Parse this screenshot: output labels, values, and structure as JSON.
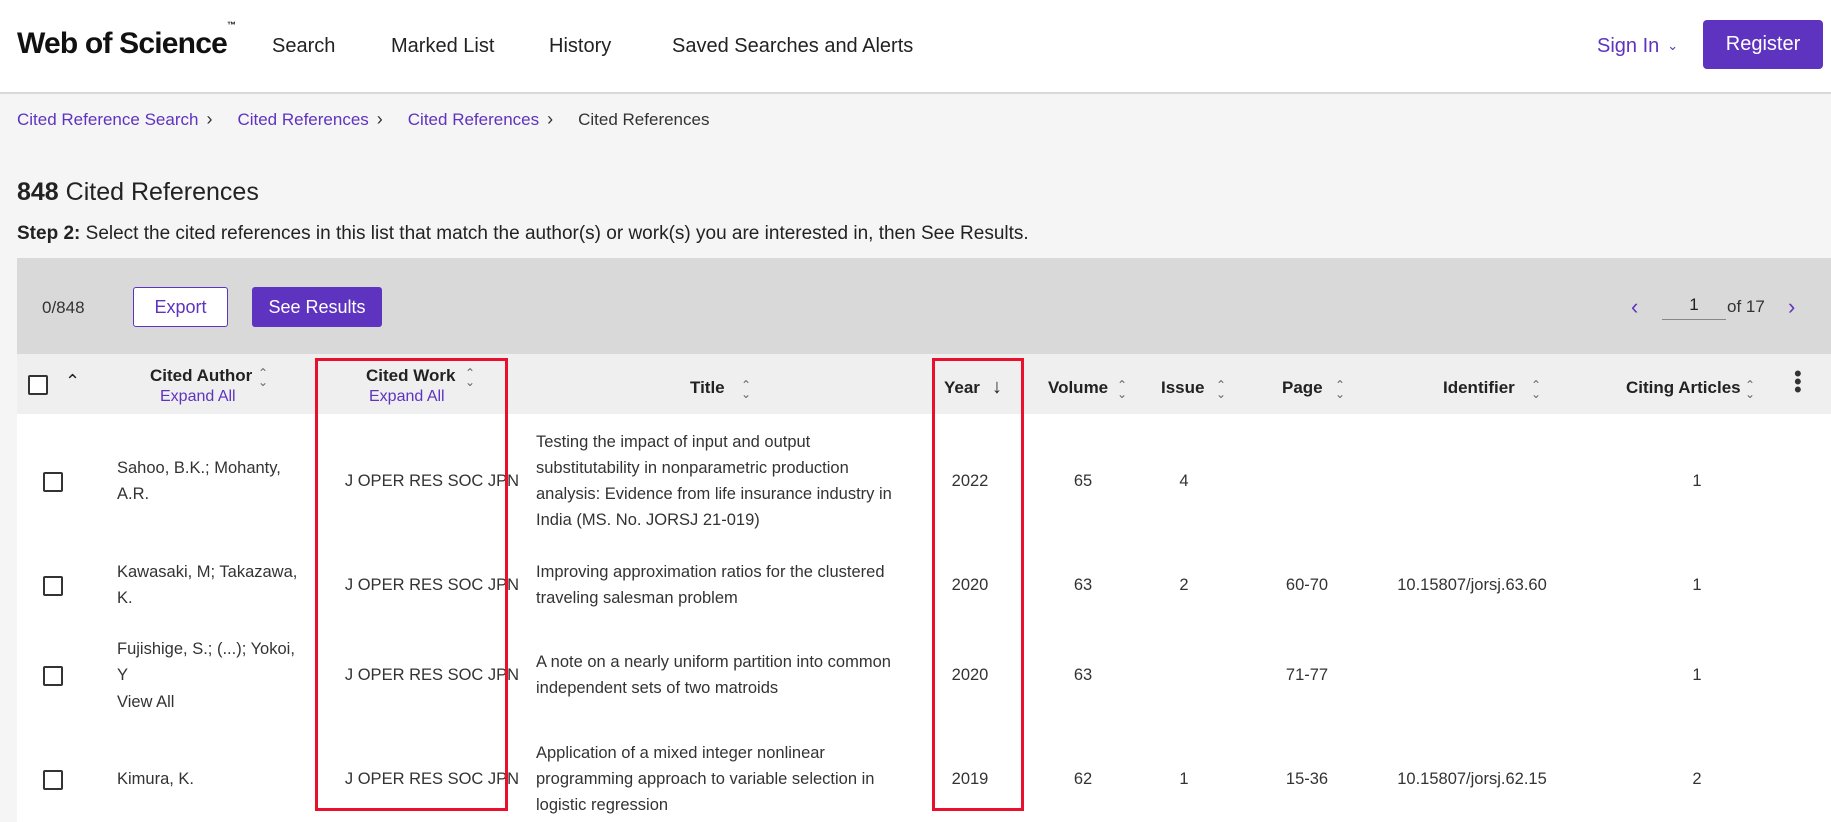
{
  "header": {
    "logo_text": "Web of Science",
    "logo_tm": "™",
    "nav": [
      "Search",
      "Marked List",
      "History",
      "Saved Searches and Alerts"
    ],
    "signin_label": "Sign In",
    "register_label": "Register"
  },
  "breadcrumb": {
    "items": [
      "Cited Reference Search",
      "Cited References",
      "Cited References"
    ],
    "current": "Cited References"
  },
  "heading": {
    "count": "848",
    "label": "Cited References"
  },
  "step": {
    "prefix": "Step 2:",
    "text": "Select the cited references in this list that match the author(s) or work(s) you are interested in, then See Results."
  },
  "toolbar": {
    "selected_count": "0/848",
    "export_label": "Export",
    "see_results_label": "See Results",
    "page": "1",
    "page_of": "of 17"
  },
  "columns": {
    "cited_author": "Cited Author",
    "cited_work": "Cited Work",
    "expand_all": "Expand All",
    "title": "Title",
    "year": "Year",
    "volume": "Volume",
    "issue": "Issue",
    "page": "Page",
    "identifier": "Identifier",
    "citing_articles": "Citing Articles"
  },
  "rows": [
    {
      "author": "Sahoo, B.K.; Mohanty, A.R.",
      "work": "J OPER RES SOC JPN",
      "title": "Testing the impact of input and output substitutability in nonparametric production analysis: Evidence from life insurance industry in India (MS. No. JORSJ 21-019)",
      "year": "2022",
      "volume": "65",
      "issue": "4",
      "page": "",
      "identifier": "",
      "citing": "1"
    },
    {
      "author": "Kawasaki, M; Takazawa, K.",
      "work": "J OPER RES SOC JPN",
      "title": "Improving approximation ratios for the clustered traveling salesman problem",
      "year": "2020",
      "volume": "63",
      "issue": "2",
      "page": "60-70",
      "identifier": "10.15807/jorsj.63.60",
      "citing": "1"
    },
    {
      "author": "Fujishige, S.; (...); Yokoi, Y",
      "view_all": "View All",
      "work": "J OPER RES SOC JPN",
      "title": "A note on a nearly uniform partition into common independent sets of two matroids",
      "year": "2020",
      "volume": "63",
      "issue": "",
      "page": "71-77",
      "identifier": "",
      "citing": "1"
    },
    {
      "author": "Kimura, K.",
      "work": "J OPER RES SOC JPN",
      "title": "Application of a mixed integer nonlinear programming approach to variable selection in logistic regression",
      "year": "2019",
      "volume": "62",
      "issue": "1",
      "page": "15-36",
      "identifier": "10.15807/jorsj.62.15",
      "citing": "2"
    }
  ],
  "colors": {
    "accent": "#5e33bf",
    "highlight": "#e8102c"
  }
}
